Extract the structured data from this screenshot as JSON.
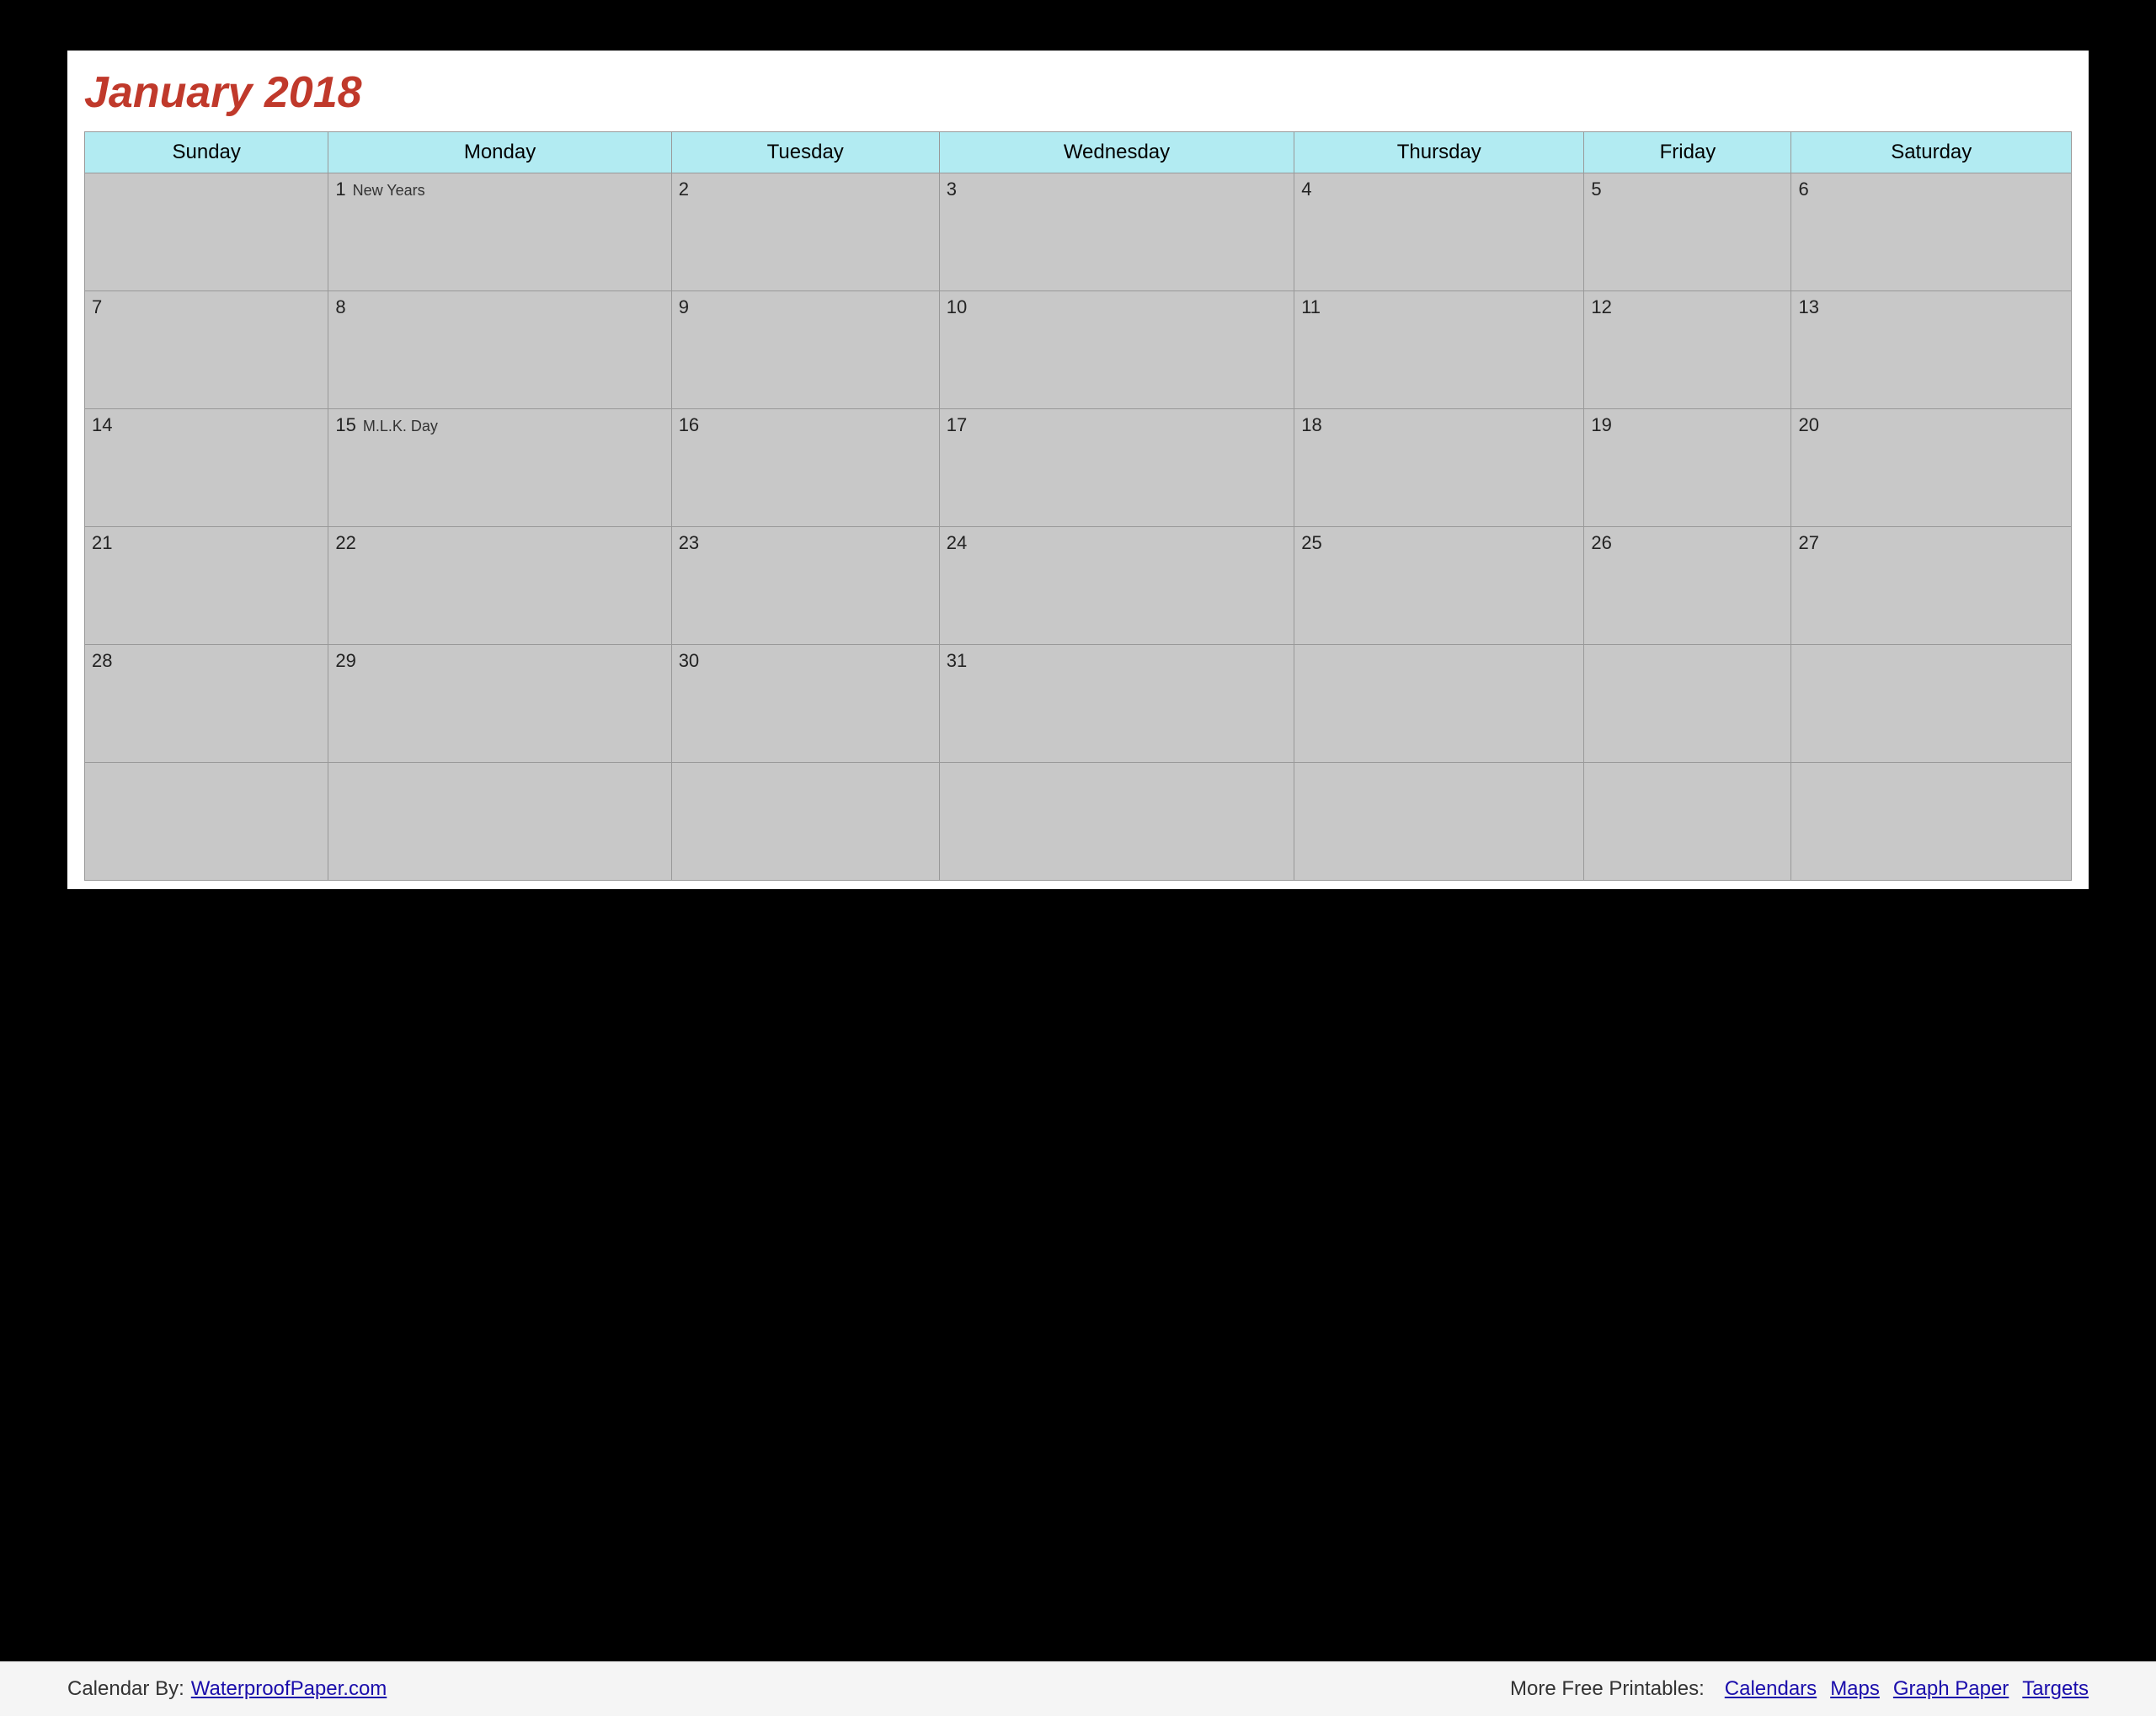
{
  "title": "January 2018",
  "days_of_week": [
    "Sunday",
    "Monday",
    "Tuesday",
    "Wednesday",
    "Thursday",
    "Friday",
    "Saturday"
  ],
  "weeks": [
    [
      {
        "day": "",
        "holiday": ""
      },
      {
        "day": "1",
        "holiday": "New Years"
      },
      {
        "day": "2",
        "holiday": ""
      },
      {
        "day": "3",
        "holiday": ""
      },
      {
        "day": "4",
        "holiday": ""
      },
      {
        "day": "5",
        "holiday": ""
      },
      {
        "day": "6",
        "holiday": ""
      }
    ],
    [
      {
        "day": "7",
        "holiday": ""
      },
      {
        "day": "8",
        "holiday": ""
      },
      {
        "day": "9",
        "holiday": ""
      },
      {
        "day": "10",
        "holiday": ""
      },
      {
        "day": "11",
        "holiday": ""
      },
      {
        "day": "12",
        "holiday": ""
      },
      {
        "day": "13",
        "holiday": ""
      }
    ],
    [
      {
        "day": "14",
        "holiday": ""
      },
      {
        "day": "15",
        "holiday": "M.L.K. Day"
      },
      {
        "day": "16",
        "holiday": ""
      },
      {
        "day": "17",
        "holiday": ""
      },
      {
        "day": "18",
        "holiday": ""
      },
      {
        "day": "19",
        "holiday": ""
      },
      {
        "day": "20",
        "holiday": ""
      }
    ],
    [
      {
        "day": "21",
        "holiday": ""
      },
      {
        "day": "22",
        "holiday": ""
      },
      {
        "day": "23",
        "holiday": ""
      },
      {
        "day": "24",
        "holiday": ""
      },
      {
        "day": "25",
        "holiday": ""
      },
      {
        "day": "26",
        "holiday": ""
      },
      {
        "day": "27",
        "holiday": ""
      }
    ],
    [
      {
        "day": "28",
        "holiday": ""
      },
      {
        "day": "29",
        "holiday": ""
      },
      {
        "day": "30",
        "holiday": ""
      },
      {
        "day": "31",
        "holiday": ""
      },
      {
        "day": "",
        "holiday": ""
      },
      {
        "day": "",
        "holiday": ""
      },
      {
        "day": "",
        "holiday": ""
      }
    ],
    [
      {
        "day": "",
        "holiday": ""
      },
      {
        "day": "",
        "holiday": ""
      },
      {
        "day": "",
        "holiday": ""
      },
      {
        "day": "",
        "holiday": ""
      },
      {
        "day": "",
        "holiday": ""
      },
      {
        "day": "",
        "holiday": ""
      },
      {
        "day": "",
        "holiday": ""
      }
    ]
  ],
  "footer": {
    "calendar_by_label": "Calendar By:",
    "waterproof_url": "WaterproofPaper.com",
    "more_free_label": "More Free Printables:",
    "links": [
      "Calendars",
      "Maps",
      "Graph Paper",
      "Targets"
    ]
  }
}
